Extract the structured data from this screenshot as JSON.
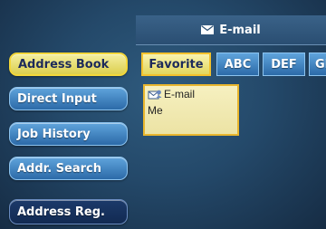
{
  "header": {
    "title": "E-mail",
    "icon": "envelope-icon"
  },
  "sidebar": {
    "items": [
      {
        "label": "Address Book",
        "state": "active"
      },
      {
        "label": "Direct Input"
      },
      {
        "label": "Job History"
      },
      {
        "label": "Addr. Search"
      },
      {
        "label": "Address Reg."
      }
    ]
  },
  "tabs": [
    {
      "label": "Favorite",
      "selected": true
    },
    {
      "label": "ABC"
    },
    {
      "label": "DEF"
    },
    {
      "label": "GHI"
    }
  ],
  "entries": [
    {
      "type": "E-mail",
      "name": "Me",
      "icon": "email-contact-icon"
    }
  ],
  "colors": {
    "accent_yellow": "#f3d73a",
    "button_blue": "#2c6aa8",
    "background": "#24496a"
  }
}
